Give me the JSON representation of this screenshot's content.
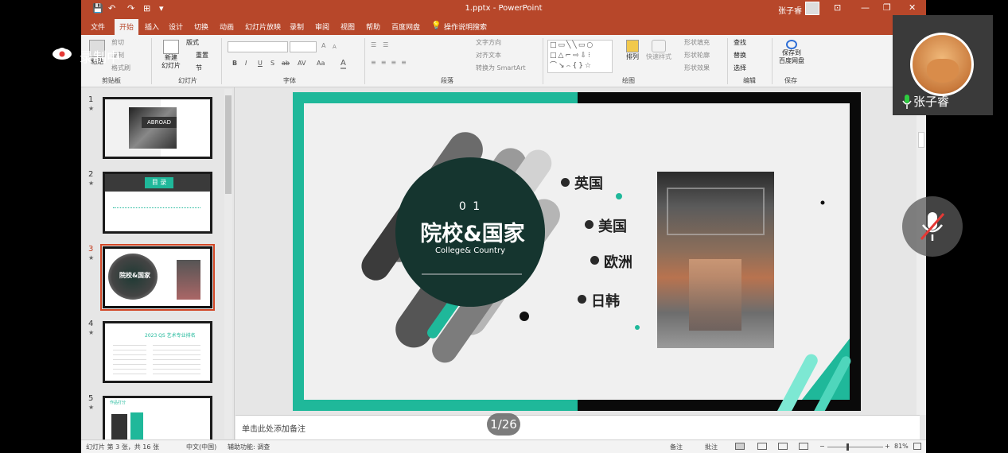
{
  "window": {
    "title": "1.pptx  -  PowerPoint",
    "user": "张子睿",
    "min": "—",
    "restore": "❐",
    "close": "✕",
    "ribbon_display": "⊡"
  },
  "qat": {
    "save": "💾",
    "undo": "↶",
    "redo": "↷",
    "present": "⊞",
    "more": "▾"
  },
  "tabs": [
    "文件",
    "开始",
    "插入",
    "设计",
    "切换",
    "动画",
    "幻灯片放映",
    "录制",
    "审阅",
    "视图",
    "帮助",
    "百度网盘"
  ],
  "tell_me": "操作说明搜索",
  "ribbon": {
    "clipboard": {
      "label": "剪贴板",
      "paste": "粘贴",
      "cut": "剪切",
      "copy": "复制",
      "format_painter": "格式刷"
    },
    "slides": {
      "label": "幻灯片",
      "new_slide": "新建\n幻灯片",
      "layout": "版式",
      "reset": "重置",
      "section": "节"
    },
    "font": {
      "label": "字体",
      "bold": "B",
      "italic": "I",
      "underline": "U",
      "strike": "S",
      "shadow": "ab",
      "spacing": "AV",
      "case": "Aa",
      "color": "A",
      "grow": "A",
      "shrink": "A"
    },
    "paragraph": {
      "label": "段落",
      "text_direction": "文字方向",
      "align_text": "对齐文本",
      "smartart": "转换为 SmartArt"
    },
    "drawing": {
      "label": "绘图",
      "arrange": "排列",
      "quick_styles": "快速样式",
      "shape_fill": "形状填充",
      "shape_outline": "形状轮廓",
      "shape_effects": "形状效果"
    },
    "editing": {
      "label": "编辑",
      "find": "查找",
      "replace": "替换",
      "select": "选择"
    },
    "save": {
      "label": "保存",
      "save_to": "保存到\n百度网盘"
    }
  },
  "thumbnails": [
    {
      "num": "1",
      "star": "★",
      "text": "ABROAD"
    },
    {
      "num": "2",
      "star": "★",
      "text": "目 录"
    },
    {
      "num": "3",
      "star": "★",
      "text": "院校&国家"
    },
    {
      "num": "4",
      "star": "★",
      "text": "2023 QS 艺术专业排名"
    },
    {
      "num": "5",
      "star": "★",
      "text": "作品打分"
    }
  ],
  "slide": {
    "number": "0 1",
    "title": "院校&国家",
    "subtitle": "College& Country",
    "countries": [
      "英国",
      "美国",
      "欧洲",
      "日韩"
    ]
  },
  "notes_placeholder": "单击此处添加备注",
  "status": {
    "slide_info": "幻灯片 第 3 张，共 16 张",
    "lang": "中文(中国)",
    "accessibility": "辅助功能: 调查",
    "notes": "备注",
    "comments": "批注",
    "zoom": "81%",
    "minus": "−",
    "plus": "+"
  },
  "overlay": {
    "recording": "录制中",
    "caller": "张子睿",
    "page": "1/26"
  },
  "colors": {
    "accent": "#b7472a",
    "teal": "#1fb89a"
  }
}
